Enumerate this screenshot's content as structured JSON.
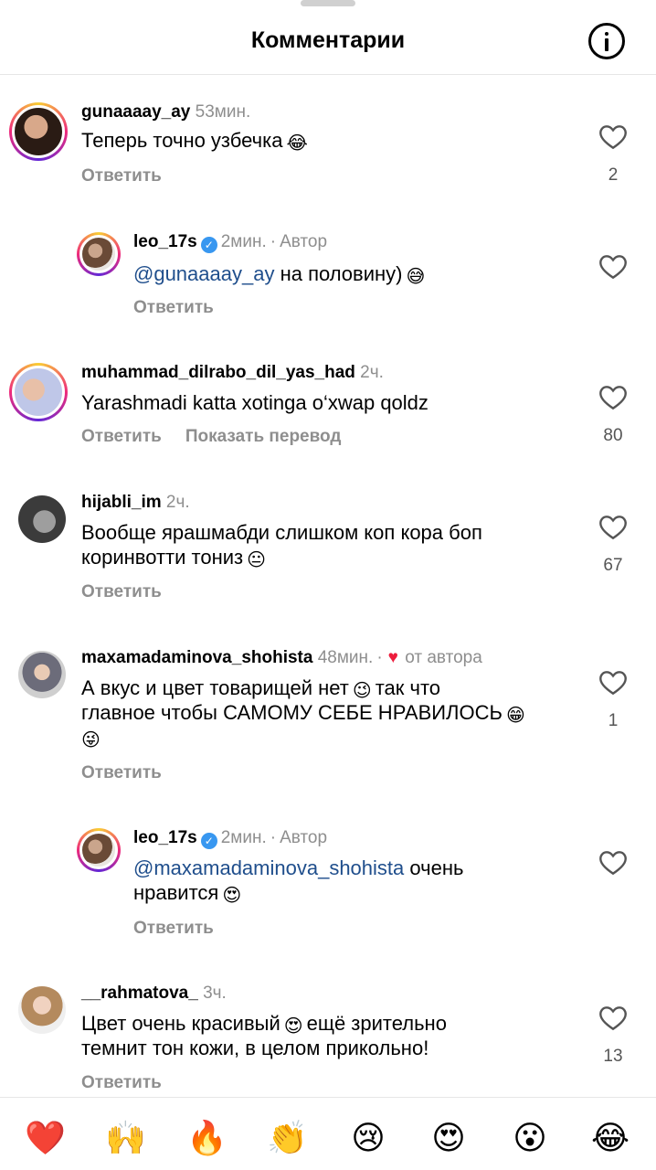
{
  "header": {
    "title": "Комментарии",
    "info_icon": "info-icon"
  },
  "comments": [
    {
      "user": "gunaaaay_ay",
      "time": "53мин.",
      "text": "Теперь точно узбечка",
      "emoji": "😂",
      "reply": "Ответить",
      "likes": "2"
    },
    {
      "user": "leo_17s",
      "time": "2мин.",
      "badge": "Автор",
      "mention": "@gunaaaay_ay",
      "text": " на половину)",
      "emoji": "😅",
      "reply": "Ответить"
    },
    {
      "user": "muhammad_dilrabo_dil_yas_had",
      "time": "2ч.",
      "text": "Yarashmadi katta xotinga o‘xwap qoldz",
      "reply": "Ответить",
      "translate": "Показать перевод",
      "likes": "80"
    },
    {
      "user": "hijabli_im",
      "time": "2ч.",
      "text_line1": "Вообще ярашмабди слишком коп кора боп",
      "text_line2": "коринвотти тониз",
      "emoji": "😐",
      "reply": "Ответить",
      "likes": "67"
    },
    {
      "user": "maxamadaminova_shohista",
      "time": "48мин.",
      "from_author": "от автора",
      "text_line1": "А вкус и цвет товарищей нет",
      "emoji1": "😉",
      "text_line1b": "так что",
      "text_line2": "главное чтобы САМОМУ СЕБЕ НРАВИЛОСЬ",
      "emoji2": "😁",
      "emoji3": "😜",
      "reply": "Ответить",
      "likes": "1"
    },
    {
      "user": "leo_17s",
      "time": "2мин.",
      "badge": "Автор",
      "mention": "@maxamadaminova_shohista",
      "text_line1b": " очень",
      "text_line2": "нравится",
      "emoji": "😍",
      "reply": "Ответить"
    },
    {
      "user": "__rahmatova_",
      "time": "3ч.",
      "text_line1": "Цвет очень красивый",
      "emoji": "😍",
      "text_line1b": "ещё зрительно",
      "text_line2": "темнит тон кожи, в целом прикольно!",
      "reply": "Ответить",
      "likes": "13"
    }
  ],
  "reactions": [
    "❤️",
    "🙌",
    "🔥",
    "👏",
    "😢",
    "😍",
    "😮",
    "😂"
  ],
  "colors": {
    "mention": "#1f4e8c",
    "secondary": "#8e8e8e",
    "heart_red": "#ed1c3c",
    "verified": "#3897f0"
  }
}
